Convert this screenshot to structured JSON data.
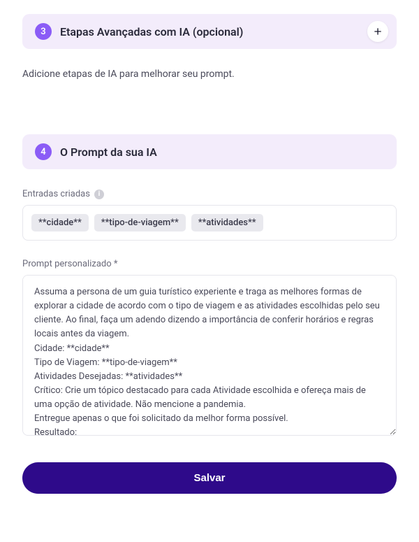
{
  "section3": {
    "step": "3",
    "title": "Etapas Avançadas com IA (opcional)",
    "description": "Adicione etapas de IA para melhorar seu prompt."
  },
  "section4": {
    "step": "4",
    "title": "O Prompt da sua IA",
    "entries_label": "Entradas criadas",
    "tags": [
      "**cidade**",
      "**tipo-de-viagem**",
      "**atividades**"
    ],
    "prompt_label": "Prompt personalizado *",
    "prompt_value": "Assuma a persona de um guia turístico experiente e traga as melhores formas de explorar a cidade de acordo com o tipo de viagem e as atividades escolhidas pelo seu cliente. Ao final, faça um adendo dizendo a importância de conferir horários e regras locais antes da viagem.\nCidade: **cidade**\nTipo de Viagem: **tipo-de-viagem**\nAtividades Desejadas: **atividades**\nCrítico: Crie um tópico destacado para cada Atividade escolhida e ofereça mais de uma opção de atividade. Não mencione a pandemia.\nEntregue apenas o que foi solicitado da melhor forma possível.\nResultado:"
  },
  "footer": {
    "save_label": "Salvar"
  }
}
